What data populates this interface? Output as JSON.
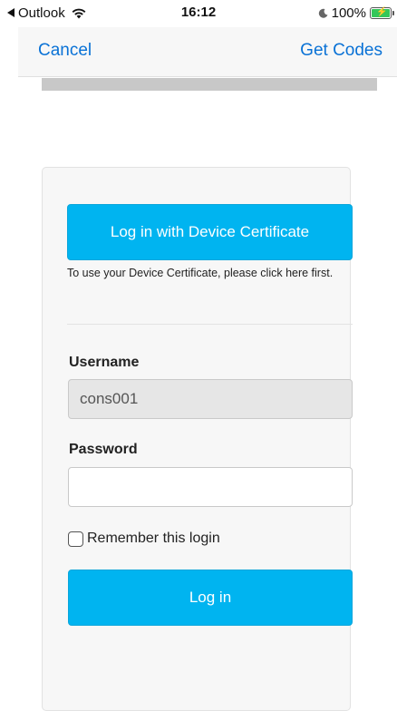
{
  "status_bar": {
    "back_app": "Outlook",
    "time": "16:12",
    "battery": "100%",
    "icons": [
      "back-arrow-icon",
      "wifi-icon",
      "moon-icon",
      "battery-charging-icon"
    ]
  },
  "nav": {
    "cancel_label": "Cancel",
    "get_codes_label": "Get Codes"
  },
  "login": {
    "cert_button_label": "Log in with Device Certificate",
    "cert_help_text": "To use your Device Certificate, please click here first.",
    "username_label": "Username",
    "username_value": "cons001",
    "password_label": "Password",
    "password_value": "",
    "remember_label": "Remember this login",
    "remember_checked": false,
    "login_button_label": "Log in"
  },
  "colors": {
    "accent": "#00b4f0",
    "link": "#0a72d6",
    "battery": "#34c759"
  }
}
